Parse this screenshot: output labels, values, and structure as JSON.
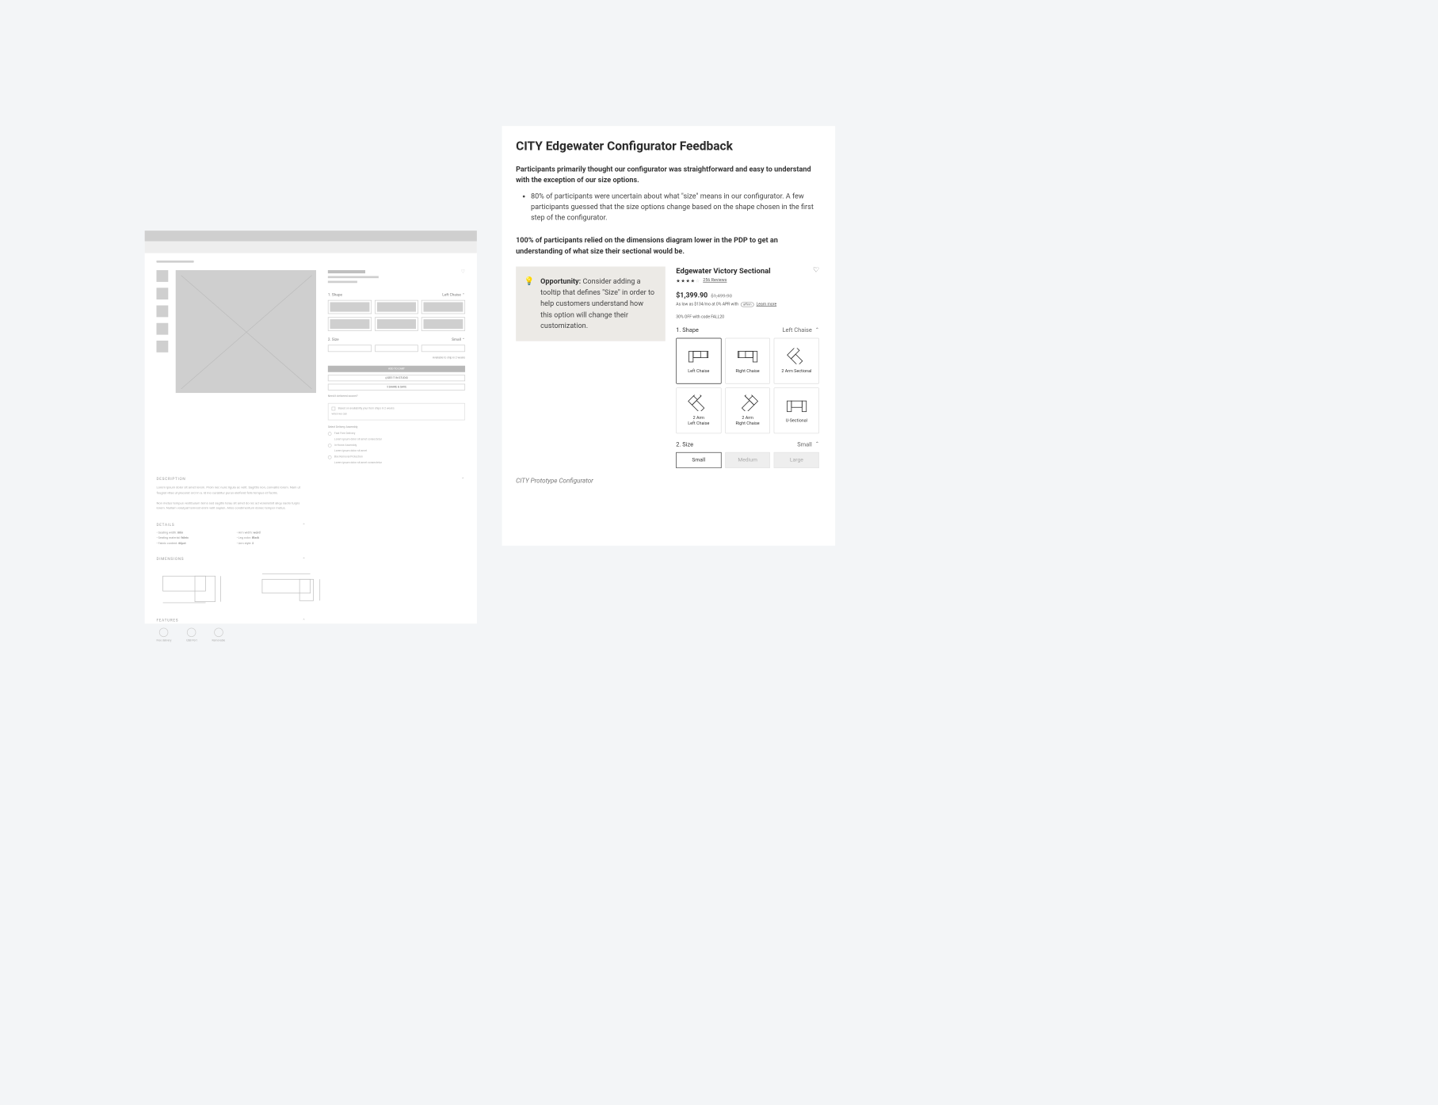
{
  "right": {
    "title": "CITY Edgewater Configurator Feedback",
    "lead": "Participants primarily thought our configurator was straightforward and easy to understand with the exception of our size options.",
    "bullet1": "80% of participants were uncertain about what \"size\" means in our configurator. A few participants guessed that the size options change based on the shape chosen in the first step of the configurator.",
    "sub": "100% of participants relied on the dimensions diagram lower in the PDP to get an understanding of what size their sectional would be.",
    "opp_label": "Opportunity:",
    "opp_text": " Consider adding a tooltip that defines \"Size\" in order to help customers understand how this option will change their customization.",
    "product_name": "Edgewater Victory Sectional",
    "reviews": "256 Reviews",
    "price": "$1,399.90",
    "price_strike": "$1,499.90",
    "finance": "As low as $134/mo at 0% APR with",
    "finance_pill": "affirm",
    "finance_link": "Learn more",
    "promo": "30% OFF with code FALL20",
    "step1": "1.  Shape",
    "step1_sel": "Left Chaise",
    "shapes": [
      "Left Chaise",
      "Right Chaise",
      "2 Arm Sectional",
      "2 Arm\nLeft Chaise",
      "2 Arm\nRight Chaise",
      "U-Sectional"
    ],
    "step2": "2.  Size",
    "step2_sel": "Small",
    "sizes": [
      "Small",
      "Medium",
      "Large"
    ],
    "caption": "CITY Prototype Configurator"
  },
  "left": {
    "sec_desc": "DESCRIPTION",
    "sec_details": "DETAILS",
    "sec_dims": "DIMENSIONS",
    "sec_feat": "FEATURES",
    "step1": "1.  Shape",
    "step1_sel": "Left Chaise",
    "step2": "2.  Size",
    "step2_sel": "Small",
    "addcart": "ADD TO CART",
    "seestudio": "SEE IT IN STUDIO",
    "share": "SHARE & SAVE",
    "avail": "Available to ship in 2 weeks"
  }
}
